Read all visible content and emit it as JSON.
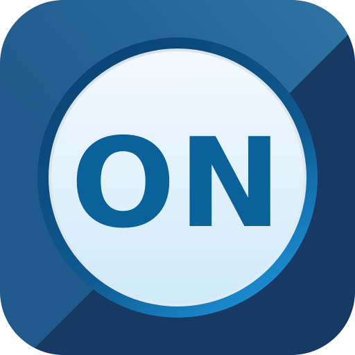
{
  "icon": {
    "label": "ON",
    "semantic": "power-on-app-icon"
  },
  "colors": {
    "tile_light": "#2b6a98",
    "tile_dark": "#173e68",
    "ring_outer": "#0d4e80",
    "ring_glow": "#1f8fd0",
    "disc_top": "#f2f8fd",
    "disc_bottom": "#cfeaf9",
    "label": "#0b6199"
  }
}
